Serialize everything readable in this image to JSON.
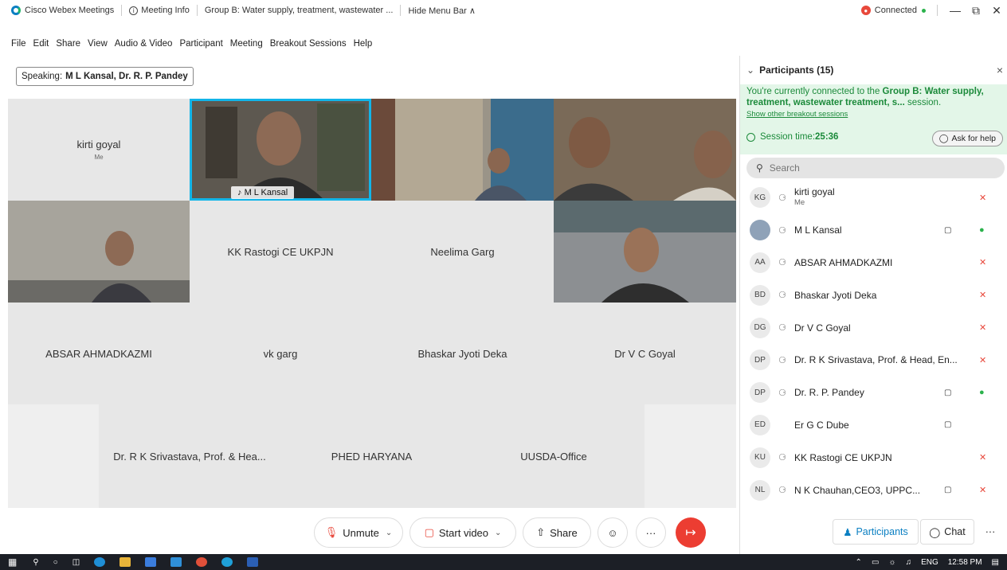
{
  "titlebar": {
    "app_name": "Cisco Webex Meetings",
    "meeting_info": "Meeting Info",
    "session_title": "Group B: Water supply, treatment, wastewater ...",
    "hide_menu": "Hide Menu Bar ∧",
    "status": "Connected",
    "min": "—",
    "max": "⧉",
    "close": "✕"
  },
  "menu": [
    "File",
    "Edit",
    "Share",
    "View",
    "Audio & Video",
    "Participant",
    "Meeting",
    "Breakout Sessions",
    "Help"
  ],
  "speaking": {
    "label": "Speaking:",
    "names": "M L Kansal, Dr. R. P. Pandey"
  },
  "tiles": [
    {
      "name": "kirti goyal",
      "sub": "Me"
    },
    {
      "name": "M L Kansal"
    },
    {
      "name": ""
    },
    {
      "name": ""
    },
    {
      "name": ""
    },
    {
      "name": "KK Rastogi CE UKPJN"
    },
    {
      "name": "Neelima Garg"
    },
    {
      "name": ""
    },
    {
      "name": "ABSAR AHMADKAZMI"
    },
    {
      "name": "vk garg"
    },
    {
      "name": "Bhaskar Jyoti Deka"
    },
    {
      "name": "Dr V C Goyal"
    },
    {
      "name": "Dr. R K Srivastava, Prof. & Hea..."
    },
    {
      "name": "PHED HARYANA"
    },
    {
      "name": "UUSDA-Office"
    }
  ],
  "controls": {
    "unmute": "Unmute",
    "start_video": "Start video",
    "share": "Share",
    "reactions": "☺",
    "more": "···",
    "leave": "↦"
  },
  "panel": {
    "title": "Participants (15)",
    "close": "×",
    "session_prefix": "You're currently connected to the ",
    "session_name": "Group B: Water supply, treatment, wastewater treatment, s...",
    "session_suffix": " session.",
    "other_sessions": "Show other breakout sessions",
    "session_time_label": "Session time: ",
    "session_time": "25:36",
    "ask_help": "Ask for help",
    "search_placeholder": "Search",
    "participants": [
      {
        "initials": "KG",
        "name": "kirti goyal",
        "sub": "Me",
        "cam": "",
        "mic": "✕"
      },
      {
        "initials": "",
        "name": "M L Kansal",
        "sub": "",
        "cam": "▢",
        "mic": "●"
      },
      {
        "initials": "AA",
        "name": "ABSAR AHMADKAZMI",
        "sub": "",
        "cam": "",
        "mic": "✕"
      },
      {
        "initials": "BD",
        "name": "Bhaskar Jyoti Deka",
        "sub": "",
        "cam": "",
        "mic": "✕"
      },
      {
        "initials": "DG",
        "name": "Dr V C Goyal",
        "sub": "",
        "cam": "",
        "mic": "✕"
      },
      {
        "initials": "DP",
        "name": "Dr. R K Srivastava, Prof. & Head, En...",
        "sub": "",
        "cam": "",
        "mic": "✕"
      },
      {
        "initials": "DP",
        "name": "Dr. R. P. Pandey",
        "sub": "",
        "cam": "▢",
        "mic": "●"
      },
      {
        "initials": "ED",
        "name": "Er G C Dube",
        "sub": "",
        "cam": "▢",
        "mic": ""
      },
      {
        "initials": "KU",
        "name": "KK Rastogi CE UKPJN",
        "sub": "",
        "cam": "",
        "mic": "✕"
      },
      {
        "initials": "NL",
        "name": "N K Chauhan,CEO3, UPPC...",
        "sub": "",
        "cam": "▢",
        "mic": "✕"
      }
    ],
    "footer": {
      "participants": "Participants",
      "chat": "Chat",
      "more": "···"
    }
  },
  "taskbar": {
    "lang": "ENG",
    "time": "12:58 PM"
  },
  "colors": {
    "accent": "#12b5e8",
    "leave": "#ec3d32",
    "session_green": "#1b8a3a",
    "muted_red": "#e8483b"
  }
}
